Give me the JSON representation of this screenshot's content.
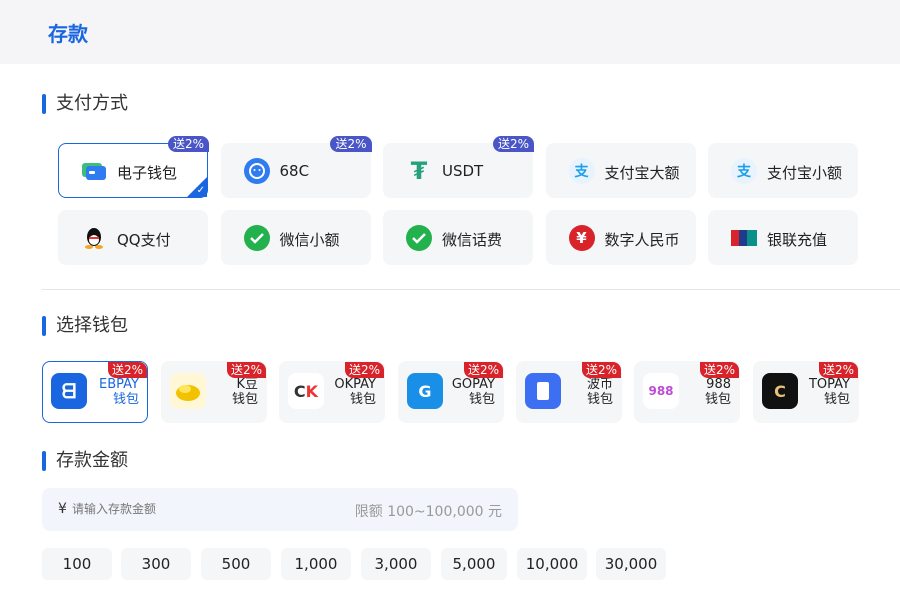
{
  "header": {
    "title": "存款"
  },
  "sections": {
    "payment_method": "支付方式",
    "select_wallet": "选择钱包",
    "deposit_amount": "存款金额"
  },
  "payment_methods": [
    {
      "label": "电子钱包",
      "badge": "送2%",
      "icon": "card-icon",
      "active": true
    },
    {
      "label": "68C",
      "badge": "送2%",
      "icon": "face-icon"
    },
    {
      "label": "USDT",
      "badge": "送2%",
      "icon": "tether-icon"
    },
    {
      "label": "支付宝大额",
      "badge": "",
      "icon": "alipay-icon"
    },
    {
      "label": "支付宝小额",
      "badge": "",
      "icon": "alipay-icon"
    },
    {
      "label": "QQ支付",
      "badge": "",
      "icon": "qq-icon"
    },
    {
      "label": "微信小额",
      "badge": "",
      "icon": "wechat-icon"
    },
    {
      "label": "微信话费",
      "badge": "",
      "icon": "wechat-icon"
    },
    {
      "label": "数字人民币",
      "badge": "",
      "icon": "yuan-icon"
    },
    {
      "label": "银联充值",
      "badge": "",
      "icon": "unionpay-icon"
    }
  ],
  "wallets": [
    {
      "name": "EBPAY",
      "sub": "钱包",
      "badge": "送2%",
      "icon": "ebpay-icon",
      "active": true
    },
    {
      "name": "K豆",
      "sub": "钱包",
      "badge": "送2%",
      "icon": "kdou-icon"
    },
    {
      "name": "OKPAY",
      "sub": "钱包",
      "badge": "送2%",
      "icon": "okpay-icon"
    },
    {
      "name": "GOPAY",
      "sub": "钱包",
      "badge": "送2%",
      "icon": "gopay-icon"
    },
    {
      "name": "波币",
      "sub": "钱包",
      "badge": "送2%",
      "icon": "bobi-icon"
    },
    {
      "name": "988",
      "sub": "钱包",
      "badge": "送2%",
      "icon": "988-icon"
    },
    {
      "name": "TOPAY",
      "sub": "钱包",
      "badge": "送2%",
      "icon": "topay-icon"
    }
  ],
  "amount": {
    "currency_symbol": "¥",
    "placeholder": "请输入存款金额",
    "value": "",
    "limit_text": "限额 100~100,000 元"
  },
  "quick_amounts": [
    "100",
    "300",
    "500",
    "1,000",
    "3,000",
    "5,000",
    "10,000",
    "30,000"
  ],
  "colors": {
    "accent": "#1a66e0",
    "badge_blue": "#4a56c8",
    "badge_red": "#d8232a"
  }
}
